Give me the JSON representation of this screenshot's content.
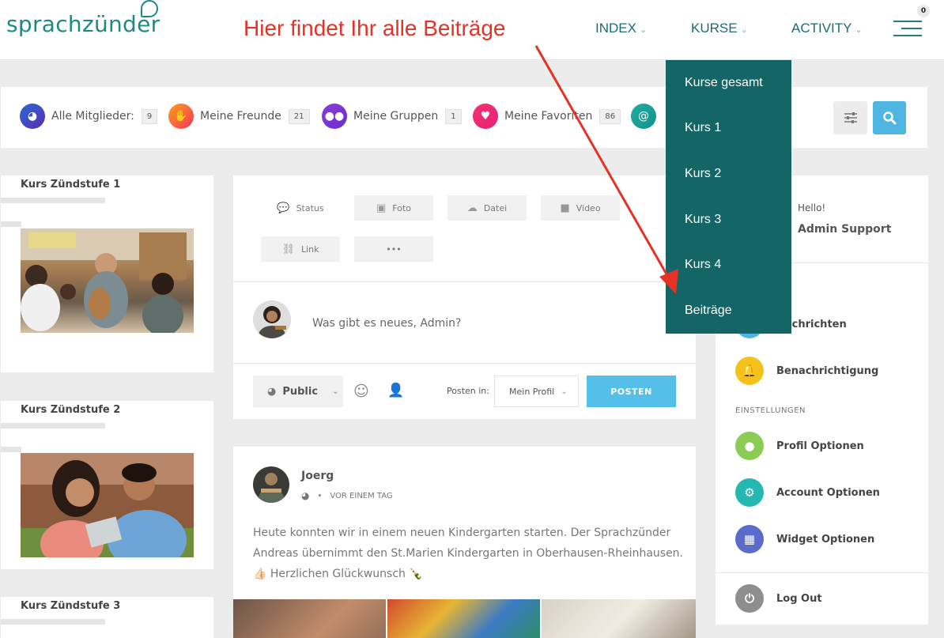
{
  "header": {
    "logo_text": "sprachzünder",
    "annotation": "Hier findet Ihr alle Beiträge",
    "nav": [
      {
        "label": "INDEX"
      },
      {
        "label": "KURSE"
      },
      {
        "label": "ACTIVITY"
      }
    ],
    "menu_badge": "0"
  },
  "filters": [
    {
      "label": "Alle Mitglieder:",
      "count": "9"
    },
    {
      "label": "Meine Freunde",
      "count": "21"
    },
    {
      "label": "Meine Gruppen",
      "count": "1"
    },
    {
      "label": "Meine Favoriten",
      "count": "86"
    }
  ],
  "courses": [
    {
      "title": "Kurs Zündstufe 1"
    },
    {
      "title": "Kurs Zündstufe 2"
    },
    {
      "title": "Kurs Zündstufe 3"
    }
  ],
  "composer": {
    "types": [
      "Status",
      "Foto",
      "Datei",
      "Video",
      "Link",
      "•••"
    ],
    "placeholder": "Was gibt es neues, Admin?",
    "privacy": "Public",
    "posten_label": "Posten in:",
    "posten_target": "Mein Profil",
    "submit": "POSTEN"
  },
  "post": {
    "author": "Joerg",
    "time": "VOR EINEM TAG",
    "text": "Heute konnten wir in einem neuen Kindergarten starten. Der Sprachzünder Andreas übernimmt den St.Marien Kindergarten in Oberhausen-Rheinhausen. 👍🏻 Herzlichen Glückwunsch 🍾"
  },
  "sidebar": {
    "greeting": "Hello!",
    "user": "Admin Support",
    "items_top": [
      {
        "label": "Nachrichten"
      },
      {
        "label": "Benachrichtigung"
      }
    ],
    "section": "EINSTELLUNGEN",
    "items_settings": [
      {
        "label": "Profil Optionen"
      },
      {
        "label": "Account Optionen"
      },
      {
        "label": "Widget Optionen"
      }
    ],
    "logout": "Log Out"
  },
  "dropdown": {
    "items": [
      "Kurse gesamt",
      "Kurs 1",
      "Kurs 2",
      "Kurs 3",
      "Kurs 4",
      "Beiträge"
    ]
  },
  "colors": {
    "brand": "#1d8a87",
    "nav": "#1a6b74",
    "annotation": "#e53226",
    "dropdown_bg": "#146565",
    "accent": "#54c0ea"
  }
}
